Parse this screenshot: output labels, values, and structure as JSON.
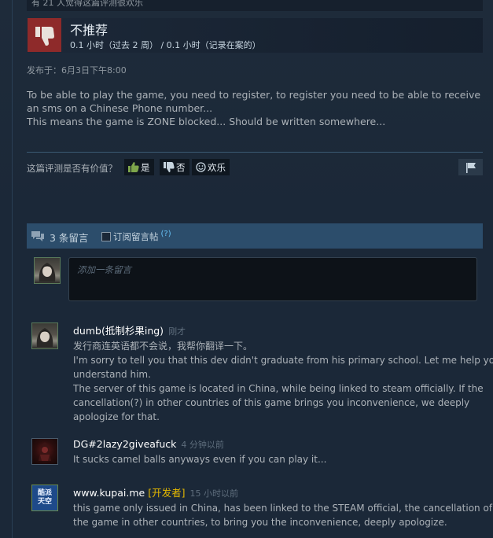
{
  "review": {
    "top_strip": "有 21 人觉得这篇评测很欢乐",
    "recommendation": "不推荐",
    "hours": "0.1 小时（过去 2 周） / 0.1 小时（记录在案的）",
    "posted": "发布于：6月3日下午8:00",
    "body_lines": [
      "To be able to play the game, you need to register, to register you need to be able to receive",
      "an sms on a Chinese Phone number...",
      "This means the game is ZONE blocked... Should be written somewhere..."
    ],
    "thumb_color": "#8e2a2a"
  },
  "helpful": {
    "question": "这篇评测是否有价值？",
    "yes": "是",
    "no": "否",
    "funny": "欢乐"
  },
  "comments_section": {
    "count_label": "3 条留言",
    "subscribe_label": "订阅留言帖",
    "help_mark": "(?)",
    "input_placeholder": "添加一条留言"
  },
  "comments": [
    {
      "author": "dumb(抵制杉果ing)",
      "time": "刚才",
      "developer_tag": "",
      "lines": [
        "发行商连英语都不会说，我帮你翻译一下。",
        "I'm sorry to tell you that this dev didn't graduate from his primary school. Let me help you",
        "understand him.",
        "The server of this game is located in China, while being linked to steam officially. If the",
        "cancellation(?) in other countries of this game brings you inconvenience, we deeply",
        "apologize for that."
      ]
    },
    {
      "author": "DG#2lazy2giveafuck",
      "time": "4 分钟以前",
      "developer_tag": "",
      "lines": [
        "It sucks camel balls anyways even if you can play it..."
      ]
    },
    {
      "author": "www.kupai.me",
      "time": "15 小时以前",
      "developer_tag": "[开发者]",
      "avatar_text": [
        "酷派",
        "天空"
      ],
      "lines": [
        "this game only issued in China, has been linked to the STEAM official, the cancellation of",
        "the game in other countries, to bring you the inconvenience, deeply apologize."
      ]
    }
  ],
  "colors": {
    "background": "#1b2838",
    "accent_blue": "#2c4d6b",
    "developer_gold": "#e5b900",
    "link_blue": "#67c1f5"
  },
  "icons": [
    "thumbs-down-icon",
    "thumbs-up-icon",
    "smiley-icon",
    "flag-icon",
    "comment-bubble-icon"
  ]
}
